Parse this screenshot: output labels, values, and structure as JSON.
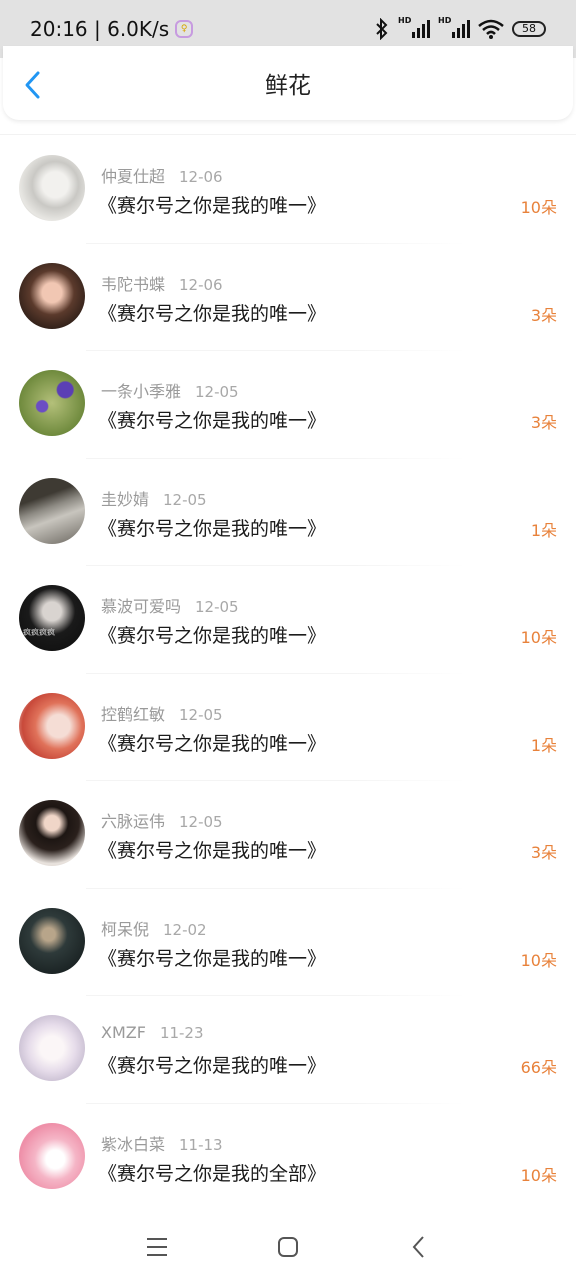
{
  "status_bar": {
    "time_speed": "20:16 | 6.0K/s",
    "battery": "58",
    "hd_label": "HD"
  },
  "header": {
    "title": "鲜花"
  },
  "colors": {
    "accent_blue": "#2196f3",
    "flower_orange": "#e8823b"
  },
  "items": [
    {
      "name": "仲夏仕超",
      "date": "12-06",
      "work": "《赛尔号之你是我的唯一》",
      "flowers": "10朵"
    },
    {
      "name": "韦陀书蝶",
      "date": "12-06",
      "work": "《赛尔号之你是我的唯一》",
      "flowers": "3朵"
    },
    {
      "name": "一条小季雅",
      "date": "12-05",
      "work": "《赛尔号之你是我的唯一》",
      "flowers": "3朵"
    },
    {
      "name": "圭妙婧",
      "date": "12-05",
      "work": "《赛尔号之你是我的唯一》",
      "flowers": "1朵"
    },
    {
      "name": "慕波可爱吗",
      "date": "12-05",
      "work": "《赛尔号之你是我的唯一》",
      "flowers": "10朵",
      "avatar_text": "疯疯疯疯"
    },
    {
      "name": "控鹤红敏",
      "date": "12-05",
      "work": "《赛尔号之你是我的唯一》",
      "flowers": "1朵"
    },
    {
      "name": "六脉运伟",
      "date": "12-05",
      "work": "《赛尔号之你是我的唯一》",
      "flowers": "3朵"
    },
    {
      "name": "柯呆倪",
      "date": "12-02",
      "work": "《赛尔号之你是我的唯一》",
      "flowers": "10朵"
    },
    {
      "name": "XMZF",
      "date": "11-23",
      "work": "《赛尔号之你是我的唯一》",
      "flowers": "66朵"
    },
    {
      "name": "紫冰白菜",
      "date": "11-13",
      "work": "《赛尔号之你是我的全部》",
      "flowers": "10朵"
    }
  ]
}
